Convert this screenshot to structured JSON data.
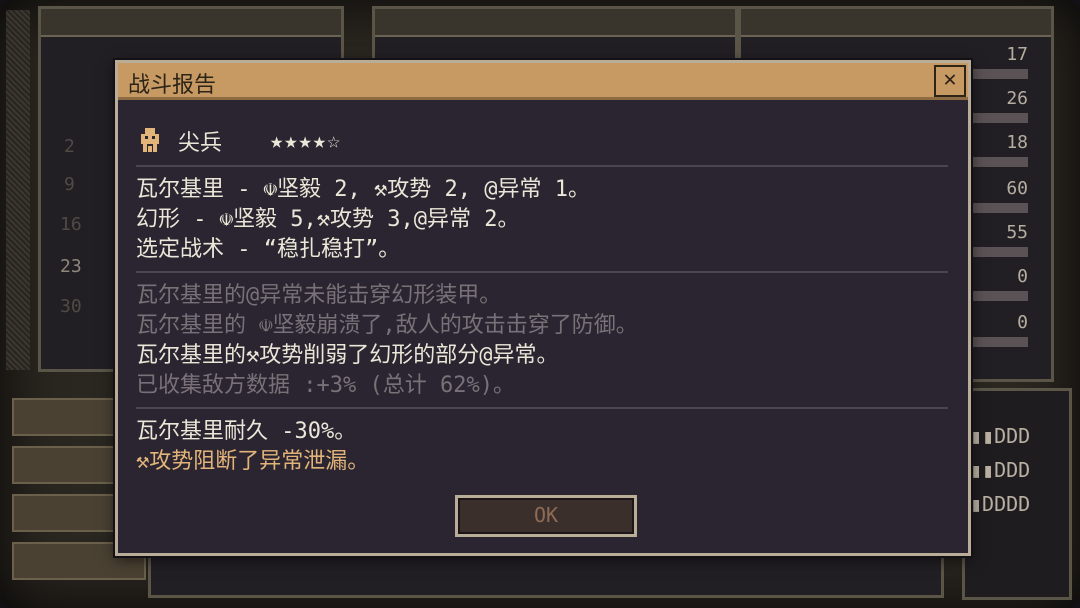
{
  "dialog": {
    "title": "战斗报告",
    "close_symbol": "✕",
    "ok_label": "OK"
  },
  "unit": {
    "name": "尖兵",
    "stars": "★★★★☆",
    "icon": "sentinel-icon"
  },
  "lines": {
    "l1_a": "瓦尔基里 - ",
    "l1_b": "坚毅 2, ",
    "l1_c": "攻势 2, ",
    "l1_d": "异常 1。",
    "l2_a": "幻形 - ",
    "l2_b": "坚毅 5,",
    "l2_c": "攻势 3,",
    "l2_d": "异常 2。",
    "l3": "选定战术 - “稳扎稳打”。",
    "l4_a": "瓦尔基里的",
    "l4_b": "异常未能击穿幻形装甲。",
    "l5_a": "瓦尔基里的 ",
    "l5_b": "坚毅崩溃了,敌人的攻击击穿了防御。",
    "l6_a": "瓦尔基里的",
    "l6_b": "攻势削弱了幻形的部分",
    "l6_c": "异常。",
    "l7": "已收集敌方数据 :+3% (总计 62%)。",
    "l8": "瓦尔基里耐久 -30%。",
    "l9": "攻势阻断了异常泄漏。"
  },
  "icons": {
    "fortitude": "fortitude-icon",
    "offense": "wrench-icon",
    "anomaly": "spiral-icon"
  },
  "background": {
    "left_numbers": [
      "2",
      "9",
      "16",
      "23",
      "30"
    ],
    "right_stats": [
      "17",
      "26",
      "18",
      "60",
      "55",
      "0",
      "0"
    ],
    "slots": [
      "▮▮DDD",
      "▮▮DDD",
      "▮DDDD"
    ]
  },
  "colors": {
    "titlebar": "#c79a63",
    "accent": "#e3b47a",
    "dim_text": "#7a7178",
    "text": "#ece6d8"
  }
}
